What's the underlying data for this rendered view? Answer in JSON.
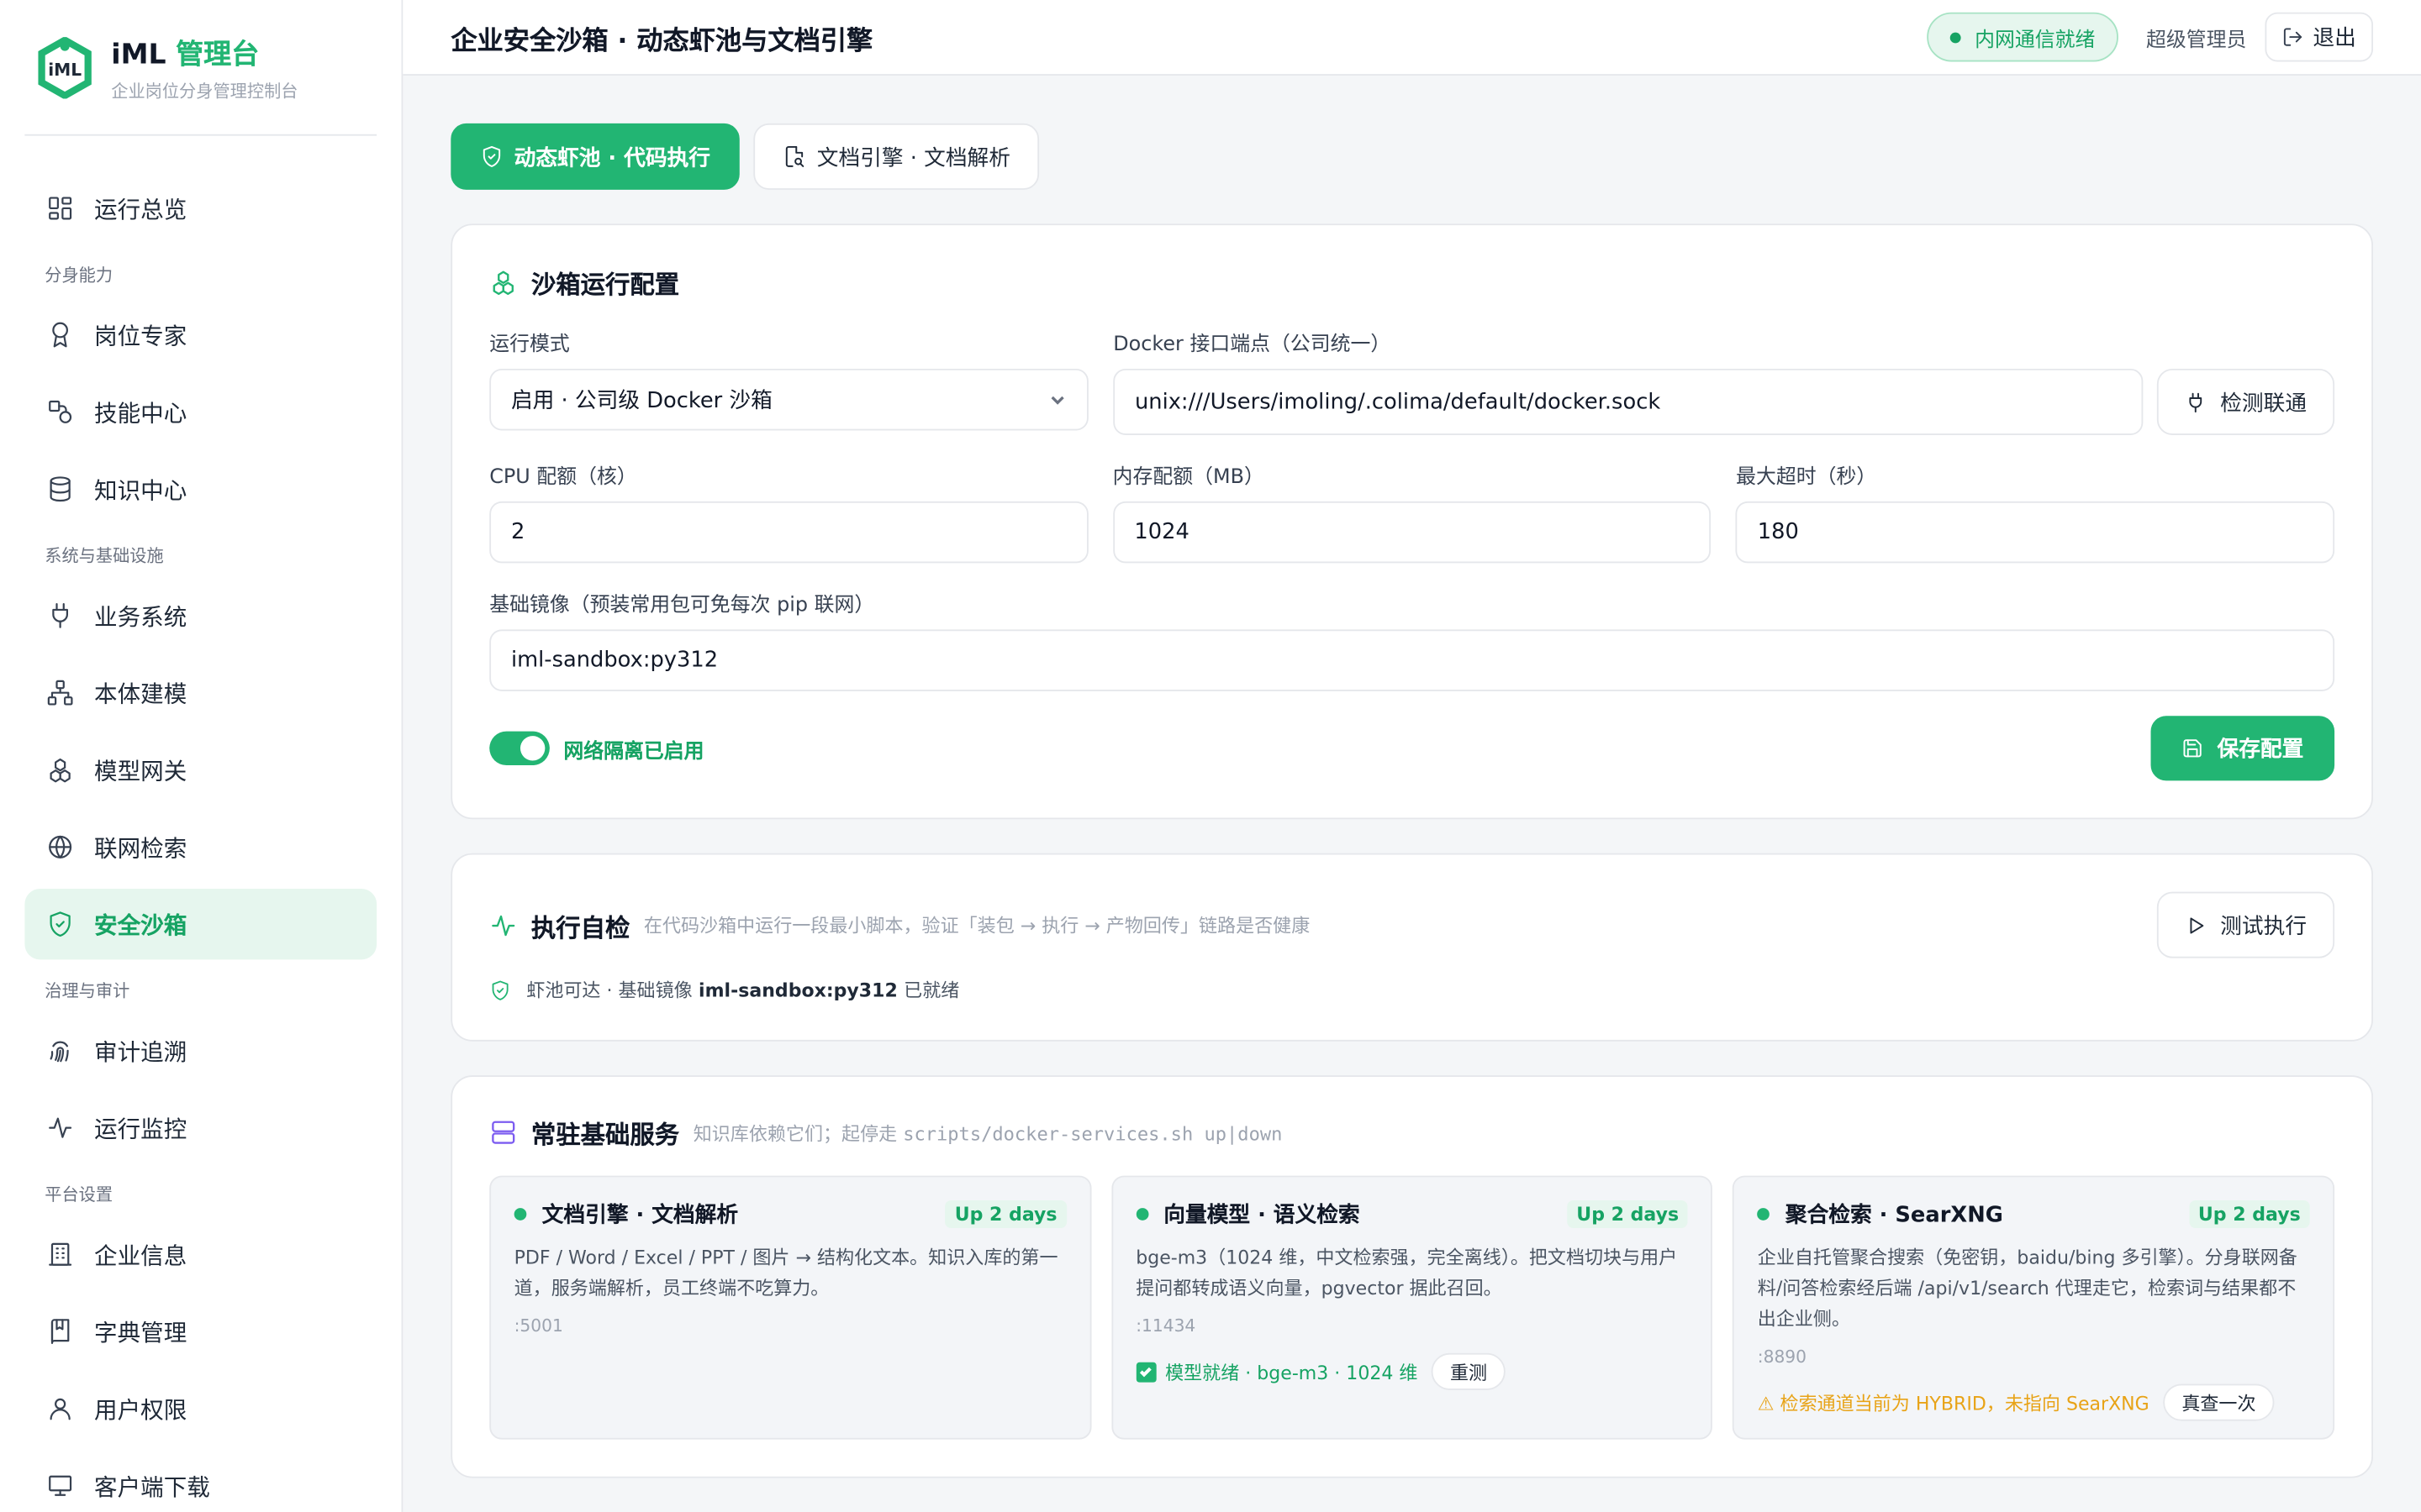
{
  "brand": {
    "name": "iML",
    "accent": "管理台",
    "subtitle": "企业岗位分身管理控制台",
    "logo_text": "iML"
  },
  "sidebar": {
    "overview": "运行总览",
    "groups": {
      "avatar": "分身能力",
      "infra": "系统与基础设施",
      "governance": "治理与审计",
      "platform": "平台设置"
    },
    "items": {
      "expert": "岗位专家",
      "skills": "技能中心",
      "knowledge": "知识中心",
      "business": "业务系统",
      "ontology": "本体建模",
      "gateway": "模型网关",
      "search": "联网检索",
      "sandbox": "安全沙箱",
      "audit": "审计追溯",
      "monitor": "运行监控",
      "company": "企业信息",
      "dict": "字典管理",
      "users": "用户权限",
      "download": "客户端下载"
    }
  },
  "header": {
    "title": "企业安全沙箱 · 动态虾池与文档引擎",
    "status": "内网通信就绪",
    "user": "超级管理员",
    "logout": "退出"
  },
  "tabs": {
    "pool": "动态虾池 · 代码执行",
    "doc": "文档引擎 · 文档解析"
  },
  "config": {
    "title": "沙箱运行配置",
    "mode_label": "运行模式",
    "mode_value": "启用 · 公司级 Docker 沙箱",
    "endpoint_label": "Docker 接口端点（公司统一）",
    "endpoint_value": "unix:///Users/imoling/.colima/default/docker.sock",
    "check_button": "检测联通",
    "cpu_label": "CPU 配额（核）",
    "cpu_value": "2",
    "mem_label": "内存配额（MB）",
    "mem_value": "1024",
    "timeout_label": "最大超时（秒）",
    "timeout_value": "180",
    "image_label": "基础镜像（预装常用包可免每次 pip 联网）",
    "image_value": "iml-sandbox:py312",
    "isolation_label": "网络隔离已启用",
    "isolation_on": true,
    "save_button": "保存配置"
  },
  "selfcheck": {
    "title": "执行自检",
    "hint": "在代码沙箱中运行一段最小脚本，验证「装包 → 执行 → 产物回传」链路是否健康",
    "test_button": "测试执行",
    "status_prefix": "虾池可达 · 基础镜像",
    "status_image": "iml-sandbox:py312",
    "status_suffix": "已就绪"
  },
  "services": {
    "title": "常驻基础服务",
    "hint_prefix": "知识库依赖它们；起停走",
    "hint_cmd": "scripts/docker-services.sh up|down",
    "items": [
      {
        "name": "文档引擎 · 文档解析",
        "uptime": "Up 2 days",
        "desc": "PDF / Word / Excel / PPT / 图片 → 结构化文本。知识入库的第一道，服务端解析，员工终端不吃算力。",
        "port": ":5001"
      },
      {
        "name": "向量模型 · 语义检索",
        "uptime": "Up 2 days",
        "desc": "bge-m3（1024 维，中文检索强，完全离线）。把文档切块与用户提问都转成语义向量，pgvector 据此召回。",
        "port": ":11434",
        "foot": "模型就绪 · bge-m3 · 1024 维",
        "foot_button": "重测"
      },
      {
        "name": "聚合检索 · SearXNG",
        "uptime": "Up 2 days",
        "desc": "企业自托管聚合搜索（免密钥，baidu/bing 多引擎）。分身联网备料/问答检索经后端 /api/v1/search 代理走它，检索词与结果都不出企业侧。",
        "port": ":8890",
        "foot": "⚠ 检索通道当前为 HYBRID，未指向 SearXNG",
        "foot_button": "真查一次"
      }
    ]
  },
  "colors": {
    "accent": "#22b573",
    "accent_dark": "#16a363",
    "accent_bg": "#e6f6ee",
    "warn": "#e8a317",
    "purple": "#7c5cf0"
  }
}
